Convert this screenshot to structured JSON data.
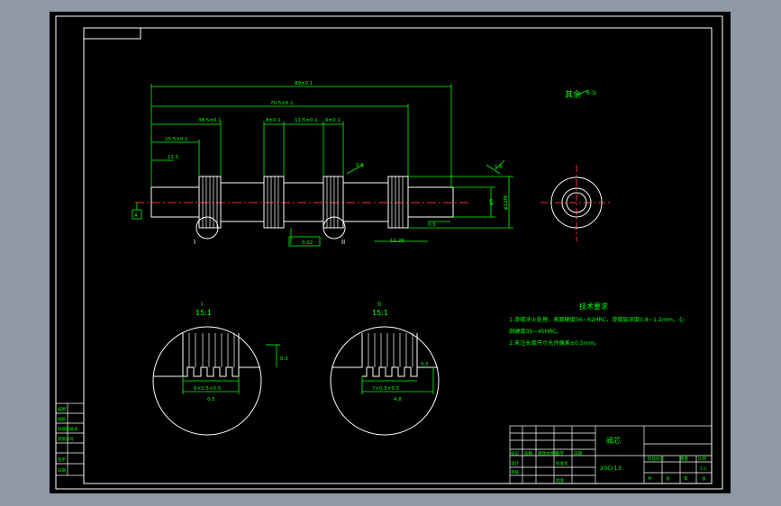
{
  "drawing": {
    "part_name": "阀芯",
    "material": "20Cr13",
    "surface_note": "其余",
    "surface_symbol": "6.3/"
  },
  "dimensions": {
    "overall": "89±0.1",
    "length_2": "70.5±0.1",
    "length_3": "38.5±0.1",
    "length_4": "25.5±0.1",
    "length_5": "11.5",
    "groove_1": "8±0.1",
    "groove_2": "11.5±0.1",
    "groove_3": "6±0.1",
    "diameter": "φ12f8",
    "end_dia": "φ8",
    "chamfer": "0.5",
    "right_end": "1.6",
    "tolerance_box": "0.02",
    "callout": "0.8",
    "runout_val": "12.28",
    "datum": "A"
  },
  "details": [
    {
      "label": "I",
      "scale": "15:1",
      "dim_a": "6×0.5×0.5",
      "dim_b": "0.5",
      "dim_c": "0.5"
    },
    {
      "label": "II",
      "scale": "15:1",
      "dim_a": "7×0.5×0.5",
      "dim_b": "4.8",
      "dim_c": "0.5"
    }
  ],
  "tech_req": {
    "title": "技术要求",
    "items": [
      "1.渗碳淬火处理，表面硬度56~62HRC，渗碳层深度0.8~1.2mm，心",
      "部硬度35~45HRC。",
      "2.未注长度尺寸允许偏差±0.5mm。"
    ]
  },
  "title_block": {
    "left_cells": [
      "描图",
      "描校",
      "旧底图总号",
      "底图总号",
      "签字",
      "日期"
    ],
    "bottom_row": [
      "标记",
      "处数",
      "更改文件号",
      "签字",
      "日期"
    ],
    "row2": [
      "设计",
      "标准化"
    ],
    "row3": [
      "审核",
      "批准"
    ],
    "weight_labels": [
      "阶段标记",
      "重量",
      "比例"
    ],
    "scale": "5:1",
    "sheet": [
      "共",
      "张",
      "第",
      "张"
    ]
  }
}
